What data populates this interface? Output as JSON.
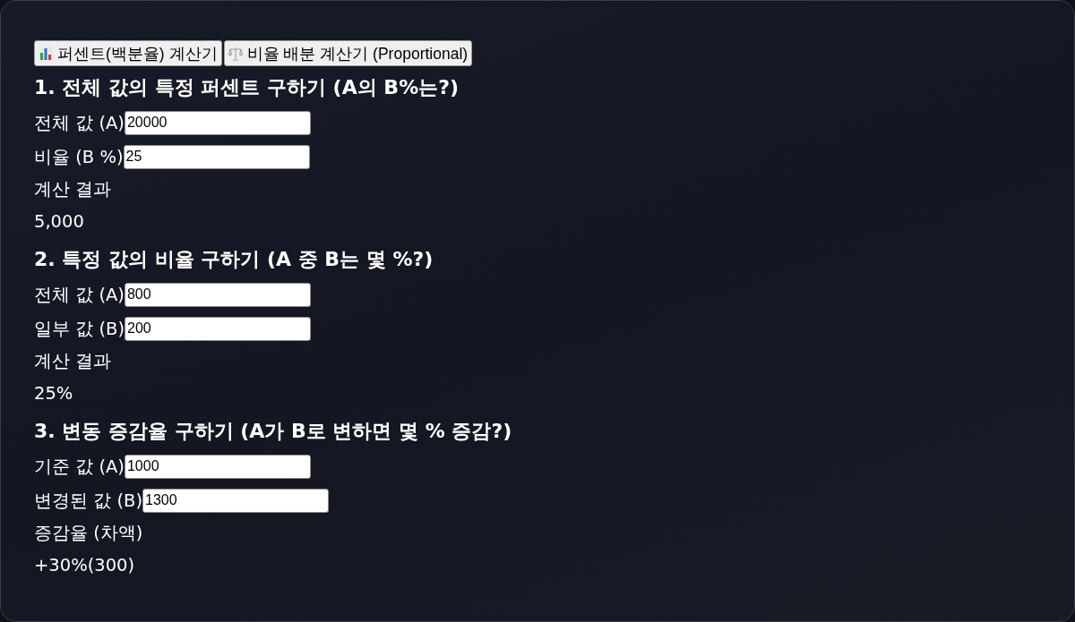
{
  "tabs": [
    {
      "kind": "percent",
      "label": "퍼센트(백분율) 계산기"
    },
    {
      "kind": "proportional",
      "label": "비율 배분 계산기 (Proportional)"
    }
  ],
  "sections": [
    {
      "title": "1. 전체 값의 특정 퍼센트 구하기 (A의 B%는?)",
      "fields": [
        {
          "label": "전체 값 (A)",
          "value": "20000"
        },
        {
          "label": "비율 (B %)",
          "value": "25"
        }
      ],
      "result_label": "계산 결과",
      "result": "5,000"
    },
    {
      "title": "2. 특정 값의 비율 구하기 (A 중 B는 몇 %?)",
      "fields": [
        {
          "label": "전체 값 (A)",
          "value": "800"
        },
        {
          "label": "일부 값 (B)",
          "value": "200"
        }
      ],
      "result_label": "계산 결과",
      "result": "25%"
    },
    {
      "title": "3. 변동 증감율 구하기 (A가 B로 변하면 몇 % 증감?)",
      "fields": [
        {
          "label": "기준 값 (A)",
          "value": "1000"
        },
        {
          "label": "변경된 값 (B)",
          "value": "1300"
        }
      ],
      "result_label": "증감율 (차액)",
      "result": "+30%(300)"
    }
  ]
}
